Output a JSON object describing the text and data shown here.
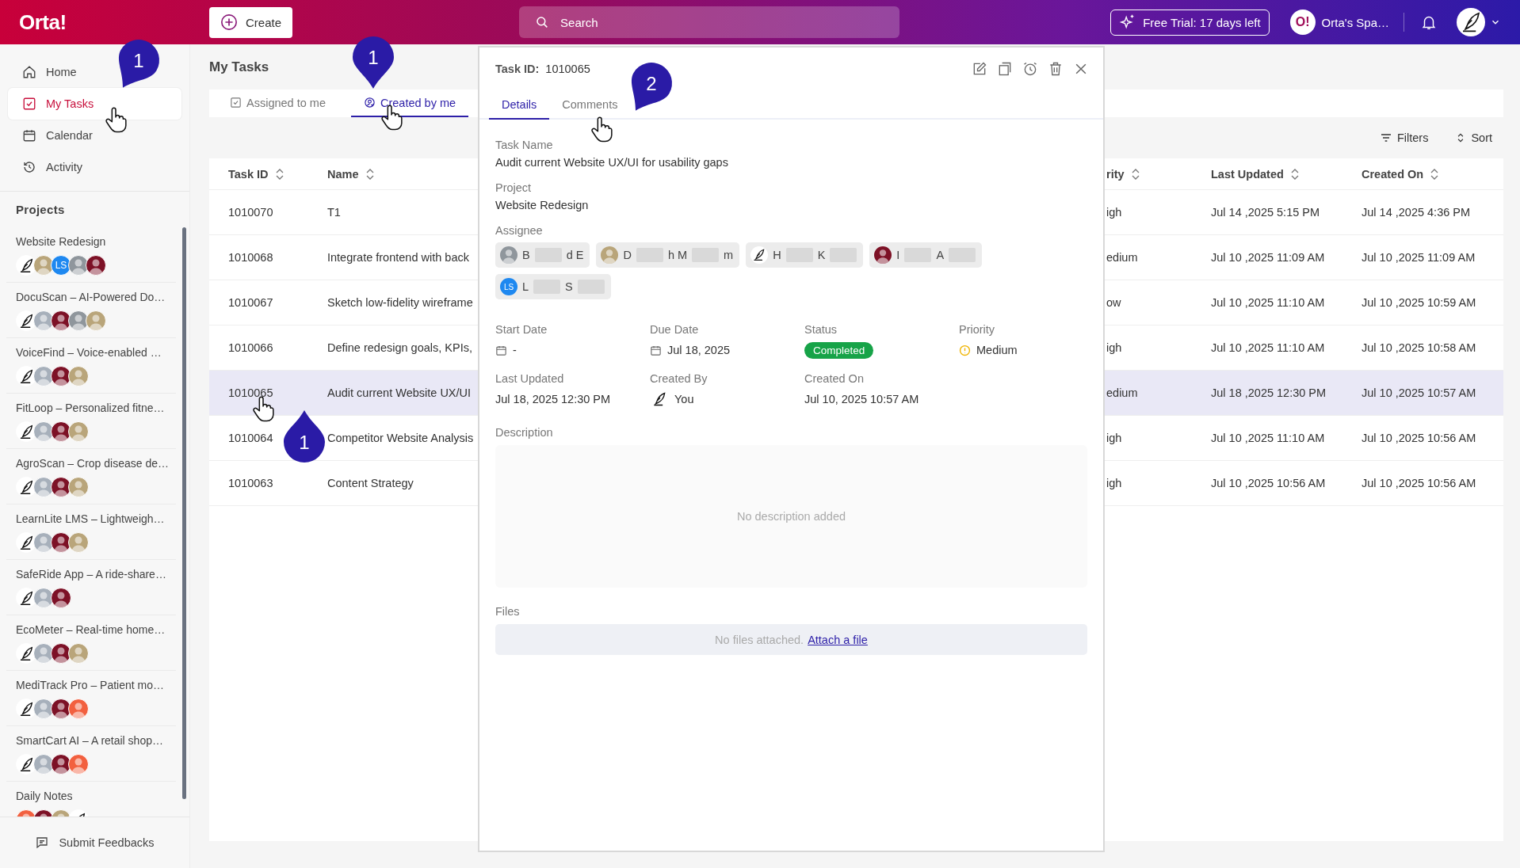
{
  "topbar": {
    "logo": "Orta!",
    "create_button": "Create",
    "search": {
      "placeholder": "Search"
    },
    "trial_button": "Free Trial: 17 days left",
    "workspace": {
      "logo": "O!",
      "name": "Orta's Spa…"
    }
  },
  "sidebar": {
    "nav": [
      {
        "label": "Home",
        "selected": false
      },
      {
        "label": "My Tasks",
        "selected": true
      },
      {
        "label": "Calendar",
        "selected": false
      },
      {
        "label": "Activity",
        "selected": false
      }
    ],
    "projects_heading": "Projects",
    "projects": [
      {
        "name": "Website Redesign",
        "avatars": [
          {
            "kind": "quill"
          },
          {
            "kind": "photo",
            "color": "#b9a57a"
          },
          {
            "kind": "initials",
            "text": "LS",
            "color": "#1e88f0"
          },
          {
            "kind": "photo",
            "color": "#8f969c"
          },
          {
            "kind": "photo",
            "color": "#7d1126"
          }
        ]
      },
      {
        "name": "DocuScan – AI-Powered Do…",
        "avatars": [
          {
            "kind": "quill"
          },
          {
            "kind": "photo",
            "color": "#a7b0bb"
          },
          {
            "kind": "photo",
            "color": "#7d1126"
          },
          {
            "kind": "photo",
            "color": "#8f969c"
          },
          {
            "kind": "photo",
            "color": "#b9a57a"
          }
        ]
      },
      {
        "name": "VoiceFind – Voice-enabled …",
        "avatars": [
          {
            "kind": "quill"
          },
          {
            "kind": "photo",
            "color": "#a7b0bb"
          },
          {
            "kind": "photo",
            "color": "#7d1126"
          },
          {
            "kind": "photo",
            "color": "#b9a57a"
          }
        ]
      },
      {
        "name": "FitLoop – Personalized fitne…",
        "avatars": [
          {
            "kind": "quill"
          },
          {
            "kind": "photo",
            "color": "#a7b0bb"
          },
          {
            "kind": "photo",
            "color": "#7d1126"
          },
          {
            "kind": "photo",
            "color": "#b9a57a"
          }
        ]
      },
      {
        "name": "AgroScan – Crop disease de…",
        "avatars": [
          {
            "kind": "quill"
          },
          {
            "kind": "photo",
            "color": "#a7b0bb"
          },
          {
            "kind": "photo",
            "color": "#7d1126"
          },
          {
            "kind": "photo",
            "color": "#b9a57a"
          }
        ]
      },
      {
        "name": "LearnLite LMS – Lightweigh…",
        "avatars": [
          {
            "kind": "quill"
          },
          {
            "kind": "photo",
            "color": "#a7b0bb"
          },
          {
            "kind": "photo",
            "color": "#7d1126"
          },
          {
            "kind": "photo",
            "color": "#b9a57a"
          }
        ]
      },
      {
        "name": "SafeRide App – A ride-share…",
        "avatars": [
          {
            "kind": "quill"
          },
          {
            "kind": "photo",
            "color": "#a7b0bb"
          },
          {
            "kind": "photo",
            "color": "#7d1126"
          }
        ]
      },
      {
        "name": "EcoMeter – Real-time home…",
        "avatars": [
          {
            "kind": "quill"
          },
          {
            "kind": "photo",
            "color": "#a7b0bb"
          },
          {
            "kind": "photo",
            "color": "#7d1126"
          },
          {
            "kind": "photo",
            "color": "#b9a57a"
          }
        ]
      },
      {
        "name": "MediTrack Pro – Patient mo…",
        "avatars": [
          {
            "kind": "quill"
          },
          {
            "kind": "photo",
            "color": "#a7b0bb"
          },
          {
            "kind": "photo",
            "color": "#7d1126"
          },
          {
            "kind": "photo",
            "color": "#f2603f"
          }
        ]
      },
      {
        "name": "SmartCart AI – A retail shop…",
        "avatars": [
          {
            "kind": "quill"
          },
          {
            "kind": "photo",
            "color": "#a7b0bb"
          },
          {
            "kind": "photo",
            "color": "#7d1126"
          },
          {
            "kind": "photo",
            "color": "#f2603f"
          }
        ]
      },
      {
        "name": "Daily Notes",
        "avatars": [
          {
            "kind": "photo",
            "color": "#f2603f"
          },
          {
            "kind": "photo",
            "color": "#7d1126"
          },
          {
            "kind": "photo",
            "color": "#b9a57a"
          },
          {
            "kind": "quill"
          }
        ]
      }
    ],
    "feedback_button": "Submit Feedbacks"
  },
  "main": {
    "title": "My Tasks",
    "tabs": [
      {
        "label": "Assigned to me",
        "selected": false
      },
      {
        "label": "Created by me",
        "selected": true
      }
    ],
    "filters_button": "Filters",
    "sort_button": "Sort",
    "table": {
      "columns": [
        "Task ID",
        "Name",
        "rity",
        "Last Updated",
        "Created On"
      ],
      "rows": [
        {
          "id": "1010070",
          "name": "T1",
          "priority": "igh",
          "last_updated": "Jul 14 ,2025 5:15 PM",
          "created_on": "Jul 14 ,2025 4:36 PM",
          "selected": false
        },
        {
          "id": "1010068",
          "name": "Integrate frontend with back",
          "priority": "edium",
          "last_updated": "Jul 10 ,2025 11:09 AM",
          "created_on": "Jul 10 ,2025 11:09 AM",
          "selected": false
        },
        {
          "id": "1010067",
          "name": "Sketch low-fidelity wireframe",
          "priority": "ow",
          "last_updated": "Jul 10 ,2025 11:10 AM",
          "created_on": "Jul 10 ,2025 10:59 AM",
          "selected": false
        },
        {
          "id": "1010066",
          "name": "Define redesign goals, KPIs,",
          "priority": "igh",
          "last_updated": "Jul 10 ,2025 11:10 AM",
          "created_on": "Jul 10 ,2025 10:58 AM",
          "selected": false
        },
        {
          "id": "1010065",
          "name": "Audit current Website UX/UI",
          "priority": "edium",
          "last_updated": "Jul 18 ,2025 12:30 PM",
          "created_on": "Jul 10 ,2025 10:57 AM",
          "selected": true
        },
        {
          "id": "1010064",
          "name": "Competitor Website Analysis",
          "priority": "igh",
          "last_updated": "Jul 10 ,2025 11:10 AM",
          "created_on": "Jul 10 ,2025 10:56 AM",
          "selected": false
        },
        {
          "id": "1010063",
          "name": "Content Strategy",
          "priority": "igh",
          "last_updated": "Jul 10 ,2025 10:56 AM",
          "created_on": "Jul 10 ,2025 10:56 AM",
          "selected": false
        }
      ]
    }
  },
  "detail_panel": {
    "task_id_label": "Task ID:",
    "task_id": "1010065",
    "tabs": [
      {
        "label": "Details",
        "selected": true
      },
      {
        "label": "Comments",
        "selected": false
      }
    ],
    "task_name": {
      "label": "Task Name",
      "value": "Audit current Website UX/UI for usability gaps"
    },
    "project": {
      "label": "Project",
      "value": "Website Redesign"
    },
    "assignee": {
      "label": "Assignee",
      "people": [
        {
          "avatar": {
            "kind": "photo",
            "color": "#8f969c"
          },
          "segments": [
            {
              "kind": "text",
              "text": "B"
            },
            {
              "kind": "blur"
            },
            {
              "kind": "text",
              "text": "d E"
            }
          ]
        },
        {
          "avatar": {
            "kind": "photo",
            "color": "#b9a57a"
          },
          "segments": [
            {
              "kind": "text",
              "text": "D"
            },
            {
              "kind": "blur"
            },
            {
              "kind": "text",
              "text": "h M"
            },
            {
              "kind": "blur"
            },
            {
              "kind": "text",
              "text": "m"
            }
          ]
        },
        {
          "avatar": {
            "kind": "quill"
          },
          "segments": [
            {
              "kind": "text",
              "text": "H"
            },
            {
              "kind": "blur"
            },
            {
              "kind": "text",
              "text": "K"
            },
            {
              "kind": "blur"
            }
          ]
        },
        {
          "avatar": {
            "kind": "photo",
            "color": "#7d1126"
          },
          "segments": [
            {
              "kind": "text",
              "text": "I"
            },
            {
              "kind": "blur"
            },
            {
              "kind": "text",
              "text": "A"
            },
            {
              "kind": "blur"
            }
          ]
        },
        {
          "avatar": {
            "kind": "initials",
            "text": "LS",
            "color": "#1e88f0"
          },
          "segments": [
            {
              "kind": "text",
              "text": "L"
            },
            {
              "kind": "blur"
            },
            {
              "kind": "text",
              "text": "S"
            },
            {
              "kind": "blur"
            }
          ]
        }
      ]
    },
    "meta": [
      {
        "label": "Start Date",
        "kind": "date",
        "value": "-"
      },
      {
        "label": "Due Date",
        "kind": "date",
        "value": "Jul 18, 2025"
      },
      {
        "label": "Status",
        "kind": "badge",
        "value": "Completed"
      },
      {
        "label": "Priority",
        "kind": "priority",
        "value": "Medium"
      },
      {
        "label": "Last Updated",
        "kind": "text",
        "value": "Jul 18, 2025 12:30 PM"
      },
      {
        "label": "Created By",
        "kind": "user",
        "value": "You"
      },
      {
        "label": "Created On",
        "kind": "text",
        "value": "Jul 10, 2025 10:57 AM"
      }
    ],
    "description": {
      "label": "Description",
      "empty_text": "No description added"
    },
    "files": {
      "label": "Files",
      "empty_text": "No files attached.",
      "link": "Attach a file"
    }
  },
  "markers": [
    {
      "number": "1"
    },
    {
      "number": "1"
    },
    {
      "number": "2"
    },
    {
      "number": "1"
    }
  ]
}
